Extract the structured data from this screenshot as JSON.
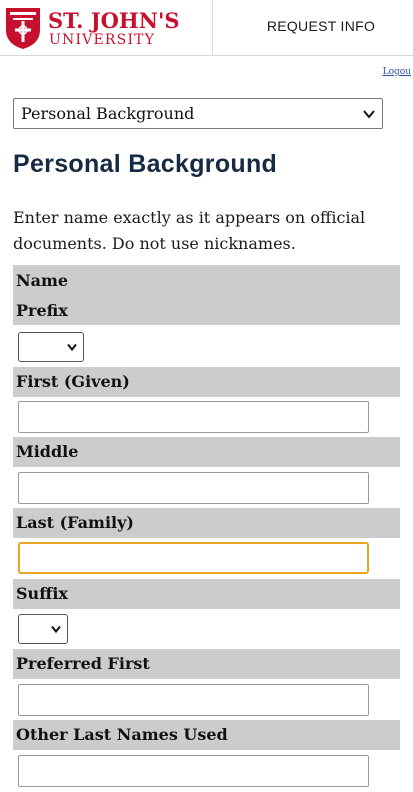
{
  "header": {
    "logo_line1": "ST. JOHN'S",
    "logo_line2": "UNIVERSITY",
    "request_info": "REQUEST INFO",
    "logout": "Logou"
  },
  "section_select": {
    "selected": "Personal Background"
  },
  "page": {
    "title": "Personal Background",
    "instructions": "Enter name exactly as it appears on official documents. Do not use nicknames."
  },
  "form": {
    "name_group_label": "Name",
    "prefix_label": "Prefix",
    "prefix_value": "",
    "first_label": "First (Given)",
    "first_value": "",
    "middle_label": "Middle",
    "middle_value": "",
    "last_label": "Last (Family)",
    "last_value": "",
    "suffix_label": "Suffix",
    "suffix_value": "",
    "preferred_first_label": "Preferred First",
    "preferred_first_value": "",
    "other_last_names_label": "Other Last Names Used",
    "other_last_names_value": ""
  },
  "colors": {
    "brand_red": "#c8102e",
    "title_navy": "#152a43",
    "label_band": "#cccccc",
    "focus_outline": "#e9a526",
    "link_blue": "#2b4fa3"
  },
  "icons": [
    "shield-crest-icon",
    "chevron-down-icon"
  ]
}
